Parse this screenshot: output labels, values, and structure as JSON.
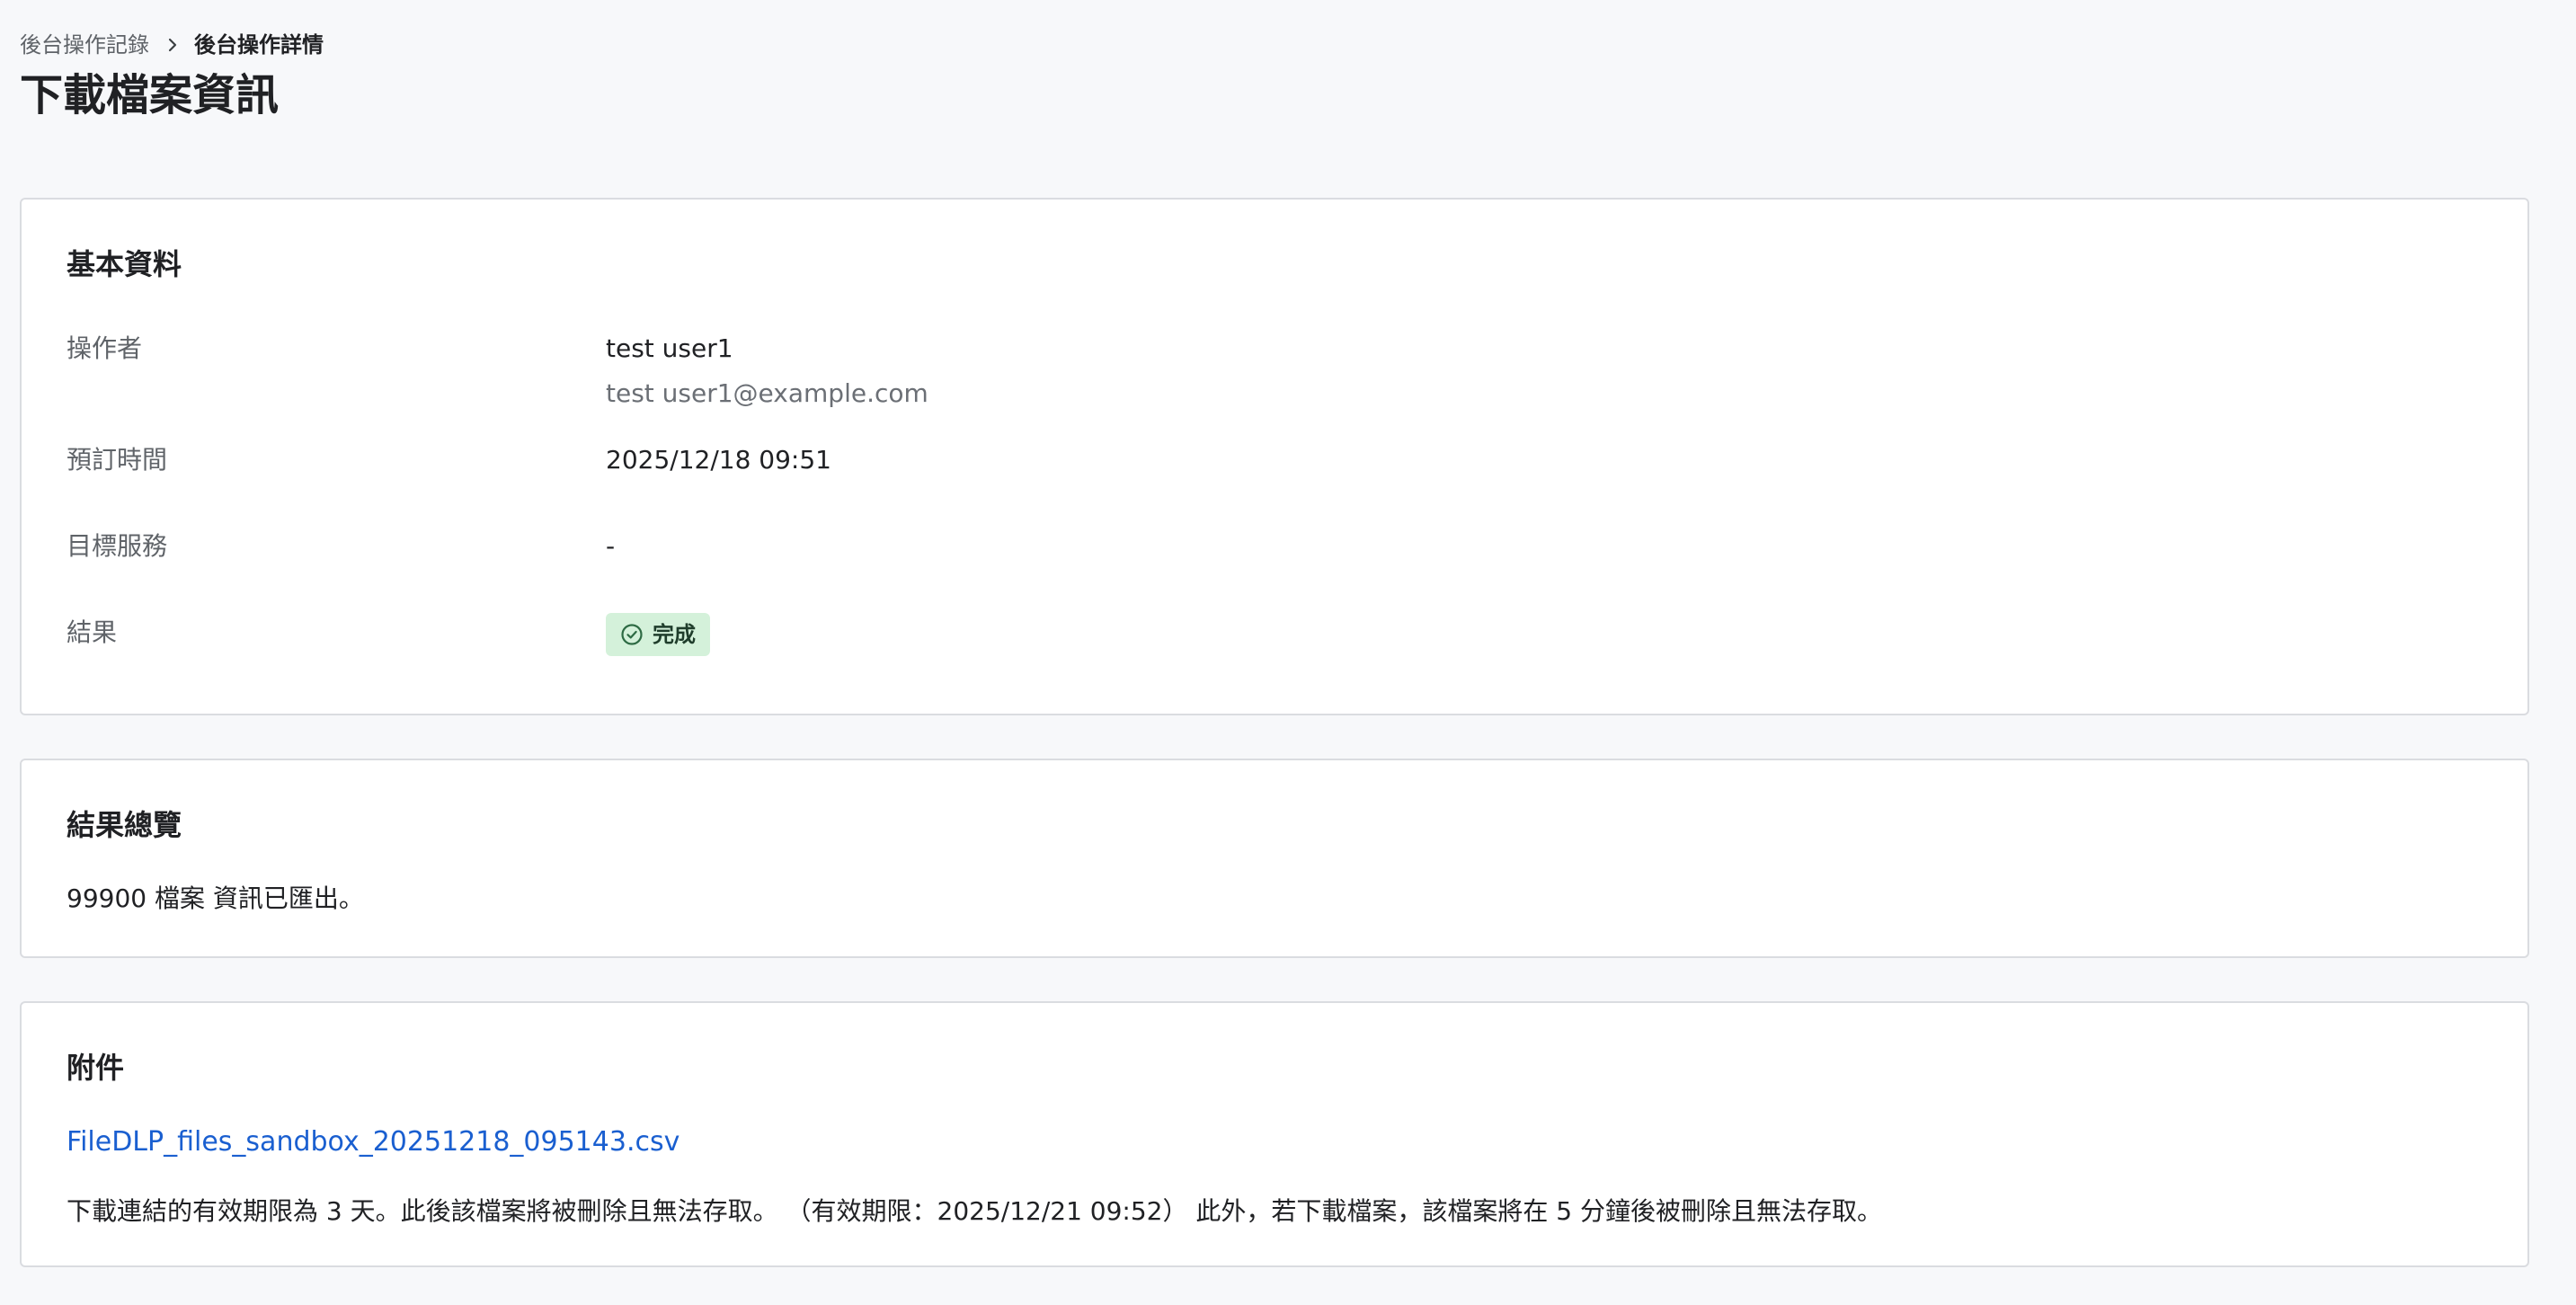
{
  "breadcrumb": {
    "parent": "後台操作記錄",
    "current": "後台操作詳情"
  },
  "page": {
    "title": "下載檔案資訊"
  },
  "basic_info": {
    "title": "基本資料",
    "operator_label": "操作者",
    "operator_name": "test user1",
    "operator_email": "test user1@example.com",
    "scheduled_time_label": "預訂時間",
    "scheduled_time": "2025/12/18 09:51",
    "target_service_label": "目標服務",
    "target_service": "-",
    "result_label": "結果",
    "result_status": "完成"
  },
  "summary": {
    "title": "結果總覽",
    "text": "99900 檔案 資訊已匯出。"
  },
  "attachments": {
    "title": "附件",
    "file_name": "FileDLP_files_sandbox_20251218_095143.csv",
    "notice": "下載連結的有效期限為 3 天。此後該檔案將被刪除且無法存取。 （有效期限：2025/12/21 09:52） 此外，若下載檔案，該檔案將在 5 分鐘後被刪除且無法存取。"
  },
  "colors": {
    "background": "#f7f8fa",
    "link": "#1a5fd0",
    "success_bg": "#d4f1da",
    "success_icon": "#2e6b44"
  },
  "icons": {
    "breadcrumb_separator": "chevron-right-icon",
    "result_status": "check-circle-icon"
  }
}
